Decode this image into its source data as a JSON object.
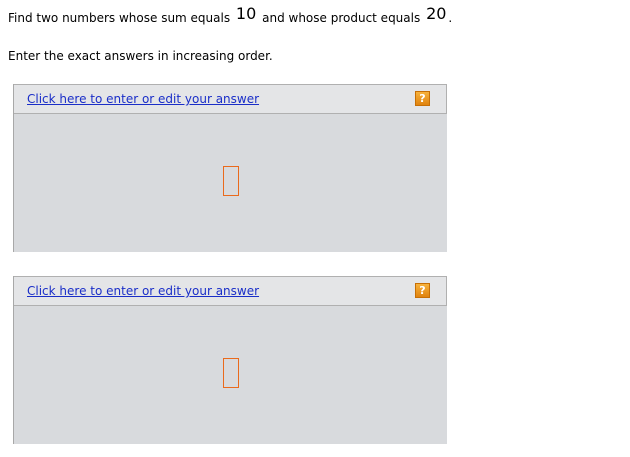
{
  "question": {
    "prefix": "Find two numbers whose sum equals",
    "sum": "10",
    "middle": "and whose product equals",
    "product": "20",
    "suffix": "."
  },
  "instructions": "Enter the exact answers in increasing order.",
  "answer_boxes": [
    {
      "link_text": "Click here to enter or edit your answer",
      "help_icon": "?"
    },
    {
      "link_text": "Click here to enter or edit your answer",
      "help_icon": "?"
    }
  ],
  "colors": {
    "link": "#1a2ec8",
    "box_background": "#d8dadd",
    "header_background": "#e4e5e7",
    "placeholder_border": "#ea6a1c",
    "help_icon": "#f0a030"
  },
  "icons": {
    "help": "question-mark-icon",
    "answer_slot": "empty-answer-slot"
  }
}
